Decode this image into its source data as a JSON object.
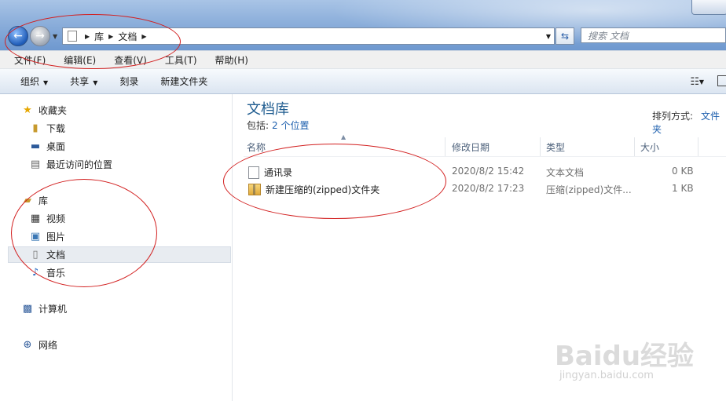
{
  "address": {
    "crumbs": [
      "库",
      "文档"
    ]
  },
  "search": {
    "placeholder": "搜索 文档"
  },
  "menu": [
    "文件(F)",
    "编辑(E)",
    "查看(V)",
    "工具(T)",
    "帮助(H)"
  ],
  "toolbar": {
    "organize": "组织",
    "share": "共享",
    "burn": "刻录",
    "new_folder": "新建文件夹"
  },
  "sidebar": {
    "favorites": "收藏夹",
    "downloads": "下载",
    "desktop": "桌面",
    "recent": "最近访问的位置",
    "libraries": "库",
    "videos": "视频",
    "pictures": "图片",
    "documents": "文档",
    "music": "音乐",
    "computer": "计算机",
    "network": "网络"
  },
  "library": {
    "title": "文档库",
    "includes_label": "包括:",
    "includes_link": "2 个位置",
    "arrange_label": "排列方式:",
    "arrange_value": "文件夹"
  },
  "columns": {
    "name": "名称",
    "modified": "修改日期",
    "type": "类型",
    "size": "大小"
  },
  "files": [
    {
      "name": "通讯录",
      "modified": "2020/8/2 15:42",
      "type": "文本文档",
      "size": "0 KB"
    },
    {
      "name": "新建压缩的(zipped)文件夹",
      "modified": "2020/8/2 17:23",
      "type": "压缩(zipped)文件...",
      "size": "1 KB"
    }
  ],
  "watermark": {
    "logo": "Baidu经验",
    "url": "jingyan.baidu.com"
  },
  "colors": {
    "accent": "#1e5b8f",
    "link": "#1d5fae",
    "annotation": "#d21f1f"
  }
}
